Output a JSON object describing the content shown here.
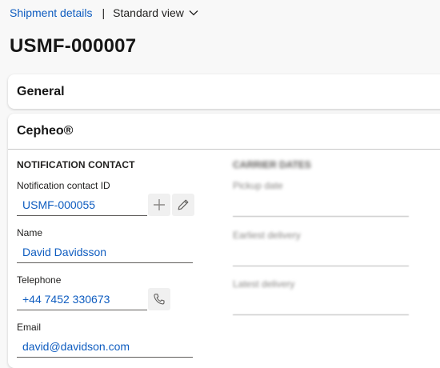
{
  "breadcrumb": {
    "link": "Shipment details",
    "separator": "|",
    "view": "Standard view"
  },
  "page_title": "USMF-000007",
  "sections": {
    "general": {
      "title": "General"
    },
    "cepheo": {
      "title": "Cepheo®",
      "notification_contact": {
        "heading": "NOTIFICATION CONTACT",
        "contact_id": {
          "label": "Notification contact ID",
          "value": "USMF-000055"
        },
        "name": {
          "label": "Name",
          "value": "David Davidsson"
        },
        "telephone": {
          "label": "Telephone",
          "value": "+44 7452 330673"
        },
        "email": {
          "label": "Email",
          "value": "david@davidson.com"
        }
      },
      "carrier_dates": {
        "heading": "CARRIER DATES",
        "pickup": {
          "label": "Pickup date"
        },
        "earliest": {
          "label": "Earliest delivery"
        },
        "latest": {
          "label": "Latest delivery"
        }
      }
    }
  },
  "icons": {
    "add": "plus-icon",
    "edit": "pencil-icon",
    "call": "phone-icon",
    "chevron": "chevron-down-icon"
  },
  "colors": {
    "link": "#0f5dc0",
    "background": "#f8f8f8",
    "card": "#ffffff"
  }
}
